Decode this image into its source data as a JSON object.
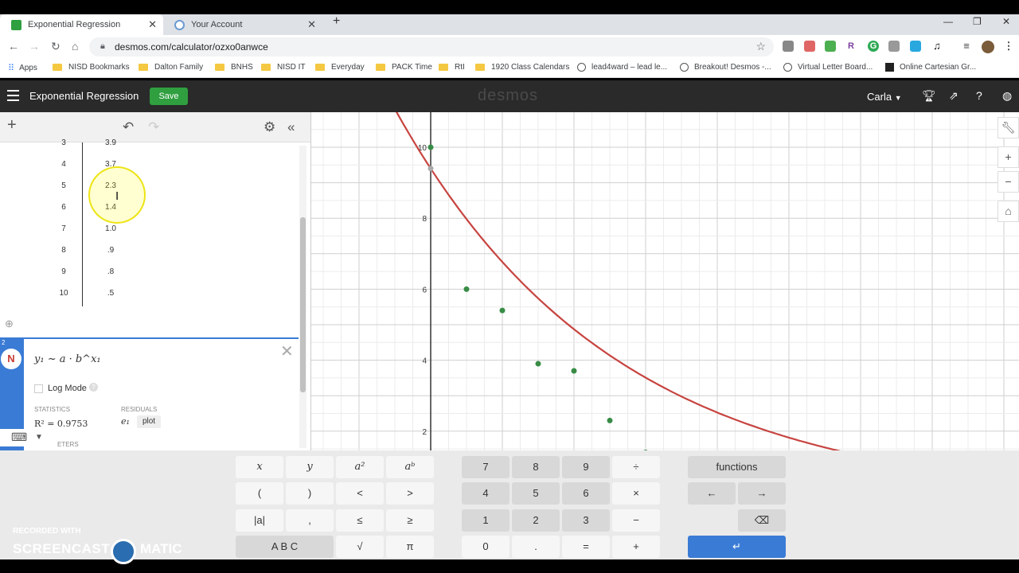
{
  "browser": {
    "tabs": [
      {
        "title": "Exponential Regression",
        "icon_color": "#2f9f3f",
        "active": true
      },
      {
        "title": "Your Account",
        "icon_color": "#6c9bd2",
        "active": false
      }
    ],
    "url": "desmos.com/calculator/ozxo0anwce",
    "bookmarks": [
      "Apps",
      "NISD Bookmarks",
      "Dalton Family",
      "BNHS",
      "NISD IT",
      "Everyday",
      "PACK Time",
      "RtI",
      "1920 Class Calendars",
      "lead4ward – lead le...",
      "Breakout! Desmos -...",
      "Virtual Letter Board...",
      "Online Cartesian Gr..."
    ],
    "extensions": [
      "R",
      "G"
    ]
  },
  "header": {
    "title": "Exponential Regression",
    "save_label": "Save",
    "logo": "desmos",
    "user": "Carla"
  },
  "table": {
    "rows": [
      {
        "x": "3",
        "y": "3.9"
      },
      {
        "x": "4",
        "y": "3.7"
      },
      {
        "x": "5",
        "y": "2.3"
      },
      {
        "x": "6",
        "y": "1.4"
      },
      {
        "x": "7",
        "y": "1.0"
      },
      {
        "x": "8",
        "y": ".9"
      },
      {
        "x": "9",
        "y": ".8"
      },
      {
        "x": "10",
        "y": ".5"
      }
    ]
  },
  "regression": {
    "index": "2",
    "expression": "y₁ ~ a · b^x₁",
    "log_mode_label": "Log Mode",
    "statistics_label": "STATISTICS",
    "residuals_label": "RESIDUALS",
    "r2": "R² = 0.9753",
    "residual_var": "e₁",
    "plot_label": "plot",
    "parameters_label": "ETERS"
  },
  "graph": {
    "y_ticks": [
      "10",
      "8",
      "6",
      "4",
      "2"
    ],
    "curve_color": "#c74440",
    "point_color": "#388c46"
  },
  "keypad": {
    "left": [
      "x",
      "y",
      "a²",
      "aᵇ",
      "(",
      ")",
      "<",
      ">",
      "|a|",
      ",",
      "≤",
      "≥",
      "A B C",
      "√",
      "π"
    ],
    "numbers": [
      "7",
      "8",
      "9",
      "÷",
      "4",
      "5",
      "6",
      "×",
      "1",
      "2",
      "3",
      "−",
      "0",
      ".",
      "=",
      "+"
    ],
    "functions_label": "functions",
    "left_arrow": "←",
    "right_arrow": "→",
    "backspace": "⌫",
    "enter": "↵"
  },
  "watermark": {
    "line1": "RECORDED WITH",
    "line2": "SCREENCAST",
    "line3": "MATIC"
  }
}
